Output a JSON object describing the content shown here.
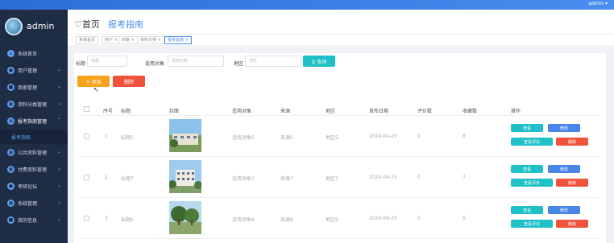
{
  "topbar": {
    "user": "admin ▾"
  },
  "sidebar": {
    "brand": "admin",
    "items": [
      {
        "label": "系统首页",
        "icon": "home-icon",
        "active": false
      },
      {
        "label": "用户管理",
        "icon": "user-icon",
        "active": false
      },
      {
        "label": "商家管理",
        "icon": "shop-icon",
        "active": false
      },
      {
        "label": "资料分类管理",
        "icon": "category-icon",
        "active": false
      },
      {
        "label": "报考指南管理",
        "icon": "guide-icon",
        "active": true
      },
      {
        "label": "公共资料管理",
        "icon": "folder-icon",
        "active": false
      },
      {
        "label": "付费资料管理",
        "icon": "pay-icon",
        "active": false
      },
      {
        "label": "考研论坛",
        "icon": "forum-icon",
        "active": false
      },
      {
        "label": "系统管理",
        "icon": "settings-icon",
        "active": false
      },
      {
        "label": "我的信息",
        "icon": "profile-icon",
        "active": false
      }
    ],
    "sub_item": "报考指南"
  },
  "header": {
    "title": "♡首页",
    "crumb": "报考指南"
  },
  "tags": [
    "系统首页",
    "用户 ×",
    "商家 ×",
    "资料分类 ×",
    "报考指南 ×"
  ],
  "search": {
    "title_label": "标题",
    "title_placeholder": "标题",
    "target_label": "适用对象",
    "target_placeholder": "适用对象",
    "region_label": "地区",
    "region_placeholder": "地区",
    "search_button": "Q 查询"
  },
  "toolbar": {
    "add_button": "+ 添加",
    "delete_button": "删除"
  },
  "table": {
    "columns": [
      "",
      "序号",
      "标题",
      "封面",
      "适用对象",
      "来源",
      "地区",
      "发布日期",
      "评价数",
      "收藏数",
      "操作"
    ],
    "rows": [
      {
        "index": "1",
        "title": "标题5",
        "target": "适用对象5",
        "source": "来源5",
        "region": "地区5",
        "date": "2024-04-25",
        "comments": "0",
        "favorites": "8"
      },
      {
        "index": "2",
        "title": "标题7",
        "target": "适用对象7",
        "source": "来源7",
        "region": "地区7",
        "date": "2024-04-25",
        "comments": "0",
        "favorites": "7"
      },
      {
        "index": "3",
        "title": "标题6",
        "target": "适用对象6",
        "source": "来源6",
        "region": "地区6",
        "date": "2024-04-25",
        "comments": "0",
        "favorites": "6"
      }
    ],
    "actions": {
      "view": "查看",
      "edit": "修改",
      "view_comments": "查看评论",
      "delete": "删除"
    }
  },
  "colors": {
    "sidebar": "#1f2d44",
    "primary": "#4a8df0",
    "cyan": "#1fc0c8",
    "red": "#f0523b",
    "orange": "#f7a21b"
  }
}
